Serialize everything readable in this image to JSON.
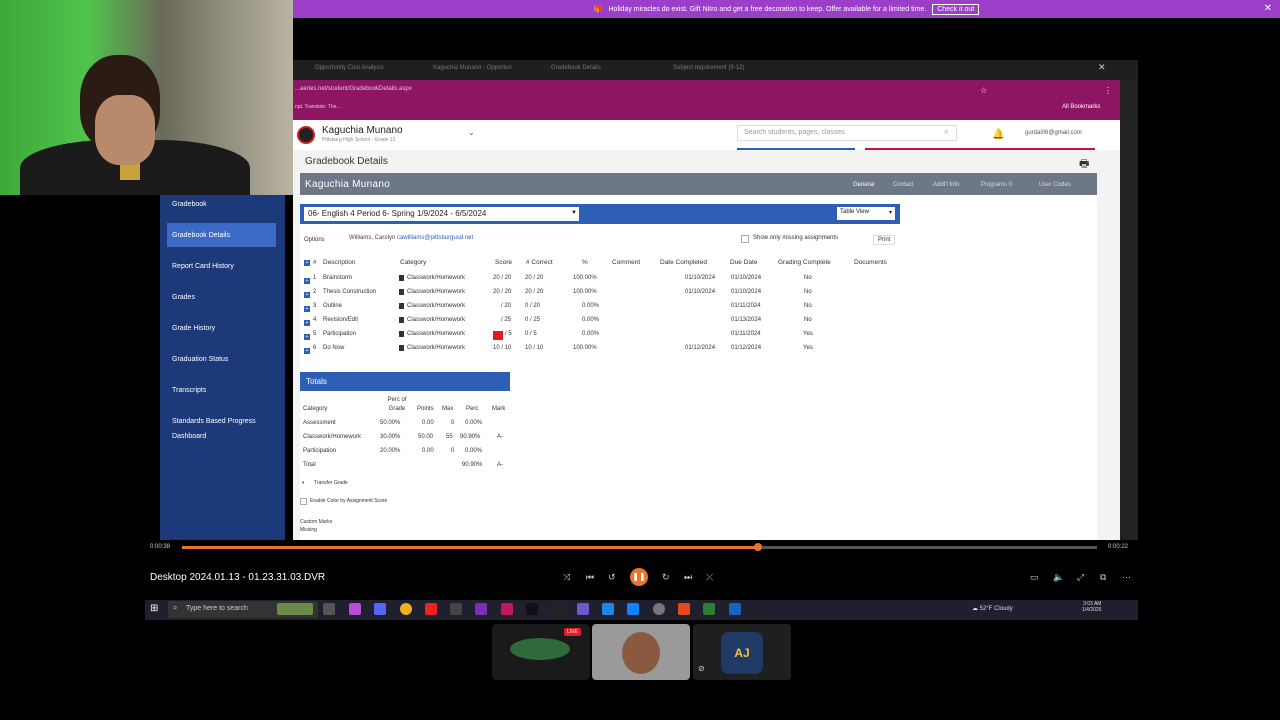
{
  "discord": {
    "banner_text": "Holiday miracles do exist. Gift Nitro and get a free decoration to keep. Offer available for a limited time.",
    "banner_button": "Check it out"
  },
  "browser": {
    "tabs": [
      "Opportunity Cost Analysis",
      "Kaguchia Munano - Opportun",
      "Gradebook Details",
      "Subject requirement (9-12)"
    ],
    "url": "...aeries.net/student/GradebookDetails.aspx",
    "bookmarks_left": "npL Translate: The...",
    "bookmarks_right": "All Bookmarks"
  },
  "app": {
    "student_name": "Kaguchia Munano",
    "student_school": "Pittsburg High School - Grade 12",
    "search_placeholder": "Search students, pages, classes",
    "user_email": "gurdai06@gmail.com",
    "page_title": "Gradebook Details",
    "name_bar": "Kaguchia Munano",
    "nav_links": [
      "General",
      "Contact",
      "Addt'l Info",
      "Programs 0",
      "User Codes"
    ],
    "sidebar": [
      "Gradebook",
      "Gradebook Details",
      "Report Card History",
      "Grades",
      "Grade History",
      "Graduation Status",
      "Transcripts",
      "Standards Based Progress",
      "Dashboard"
    ],
    "course": "06- English 4 Period 6- Spring 1/9/2024 - 6/5/2024",
    "table_view": "Table View",
    "options_label": "Options",
    "teacher_name": "Williams, Carolyn",
    "teacher_email": "cawilliams@pittsburgusd.net",
    "missing_label": "Show only missing assignments",
    "print_label": "Print"
  },
  "assignments": {
    "headers": [
      "#",
      "Description",
      "Category",
      "Score",
      "# Correct",
      "%",
      "Comment",
      "Date Completed",
      "Due Date",
      "Grading Complete",
      "Documents"
    ],
    "rows": [
      {
        "num": "1",
        "desc": "Brainstorm",
        "cat": "Classwork/Homework",
        "score": "20 / 20",
        "correct": "20 / 20",
        "pct": "100.00%",
        "completed": "01/10/2024",
        "due": "01/10/2024",
        "graded": "No"
      },
      {
        "num": "2",
        "desc": "Thesis Construction",
        "cat": "Classwork/Homework",
        "score": "20 / 20",
        "correct": "20 / 20",
        "pct": "100.00%",
        "completed": "01/10/2024",
        "due": "01/10/2024",
        "graded": "No"
      },
      {
        "num": "3",
        "desc": "Outline",
        "cat": "Classwork/Homework",
        "score": "/ 20",
        "correct": "0 / 20",
        "pct": "0.00%",
        "completed": "",
        "due": "01/11/2024",
        "graded": "No"
      },
      {
        "num": "4",
        "desc": "Revision/Edit",
        "cat": "Classwork/Homework",
        "score": "/ 25",
        "correct": "0 / 25",
        "pct": "0.00%",
        "completed": "",
        "due": "01/13/2024",
        "graded": "No"
      },
      {
        "num": "5",
        "desc": "Participation",
        "cat": "Classwork/Homework",
        "score": "/ 5",
        "correct": "0 / 5",
        "pct": "0.00%",
        "completed": "",
        "due": "01/11/2024",
        "graded": "Yes"
      },
      {
        "num": "6",
        "desc": "Do Now",
        "cat": "Classwork/Homework",
        "score": "10 / 10",
        "correct": "10 / 10",
        "pct": "100.00%",
        "completed": "01/12/2024",
        "due": "01/12/2024",
        "graded": "Yes"
      }
    ]
  },
  "totals": {
    "title": "Totals",
    "headers": [
      "Category",
      "Perc of Grade",
      "Points",
      "Max",
      "Perc",
      "Mark"
    ],
    "rows": [
      {
        "cat": "Assessment",
        "perc_grade": "50.00%",
        "points": "0.00",
        "max": "0",
        "perc": "0.00%",
        "mark": ""
      },
      {
        "cat": "Classwork/Homework",
        "perc_grade": "30.00%",
        "points": "50.00",
        "max": "55",
        "perc": "90.90%",
        "mark": "A-"
      },
      {
        "cat": "Participation",
        "perc_grade": "20.00%",
        "points": "0.00",
        "max": "0",
        "perc": "0.00%",
        "mark": ""
      },
      {
        "cat": "Total",
        "perc_grade": "",
        "points": "",
        "max": "",
        "perc": "90.90%",
        "mark": "A-"
      }
    ],
    "transfer_label": "Transfer Grade",
    "enable_color_label": "Enable Color by Assignment Score",
    "custom_marks": "Custom Marks",
    "missing": "Missing"
  },
  "player": {
    "title": "Desktop 2024.01.13 - 01.23.31.03.DVR",
    "time_current": "0:00:38",
    "time_total": "0:00:22",
    "progress": 0.63
  },
  "taskbar": {
    "search_placeholder": "Type here to search",
    "weather": "52°F Cloudy",
    "time": "3:03 AM",
    "date": "1/4/2026"
  },
  "participants": {
    "live_label": "LIVE",
    "avatar_text": "AJ"
  },
  "colors": {
    "accent_blue": "#2d5fb5",
    "browser_magenta": "#8e1464",
    "discord_purple": "#9b3fc9",
    "player_orange": "#e8752b",
    "sidebar_navy": "#1c3a7a"
  }
}
